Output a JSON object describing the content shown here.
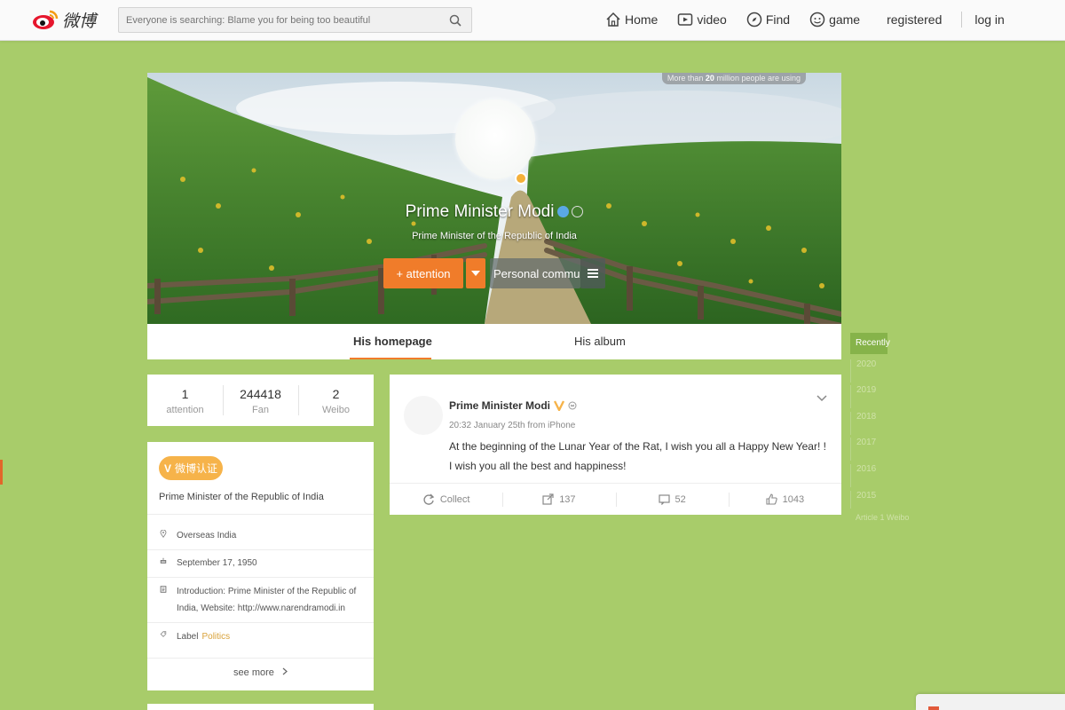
{
  "header": {
    "logo_text": "微博",
    "search_placeholder": "Everyone is searching: Blame you for being too beautiful",
    "nav": [
      {
        "label": "Home",
        "icon": "home-icon"
      },
      {
        "label": "video",
        "icon": "video-icon"
      },
      {
        "label": "Find",
        "icon": "find-icon"
      },
      {
        "label": "game",
        "icon": "game-icon"
      }
    ],
    "registered_label": "registered",
    "login_label": "log in"
  },
  "cover": {
    "badge_prefix": "More than ",
    "badge_number": "20",
    "badge_suffix": " million people are using",
    "name": "Prime Minister Modi",
    "description": "Prime Minister of the Republic of India",
    "attention_label": "+ attention",
    "community_label": "Personal commun"
  },
  "tabs": [
    {
      "label": "His homepage",
      "active": true
    },
    {
      "label": "His album",
      "active": false
    }
  ],
  "stats": [
    {
      "value": "1",
      "label": "attention"
    },
    {
      "value": "244418",
      "label": "Fan"
    },
    {
      "value": "2",
      "label": "Weibo"
    }
  ],
  "info": {
    "verified_label": "微博认证",
    "title": "Prime Minister of the Republic of India",
    "location": "Overseas India",
    "birthday": "September 17, 1950",
    "introduction": "Introduction: Prime Minister of the Republic of India, Website: http://www.narendramodi.in",
    "label_prefix": "Label",
    "label_value": "Politics",
    "see_more": "see more"
  },
  "post": {
    "author": "Prime Minister Modi",
    "meta": "20:32 January 25th from iPhone",
    "text": "At the beginning of the Lunar Year of the Rat, I wish you all a Happy New Year! ! I wish you all the best and happiness!",
    "actions": {
      "collect": "Collect",
      "forward": "137",
      "comment": "52",
      "like": "1043"
    }
  },
  "timeline": {
    "active": "Recently",
    "items": [
      "2020",
      "2019",
      "2018",
      "2017",
      "2016",
      "2015"
    ],
    "more": "Article 1 Weibo"
  },
  "colors": {
    "background": "#a8cc6a",
    "accent": "#f07c2a",
    "verified": "#f6b34a"
  }
}
